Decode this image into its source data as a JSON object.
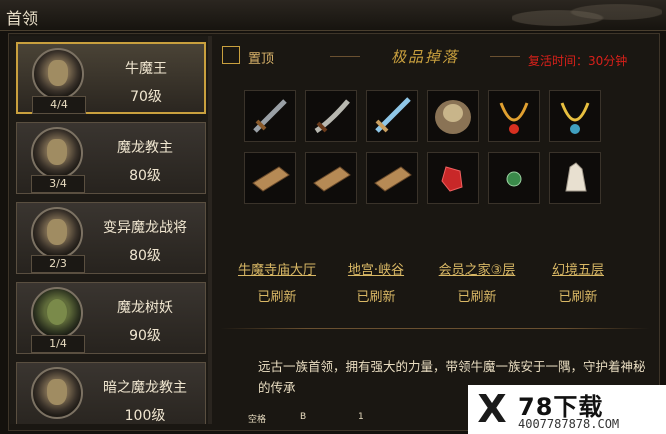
{
  "window": {
    "title": "首领"
  },
  "bosses": [
    {
      "name": "牛魔王",
      "level": "70级",
      "count": "4/4",
      "icon": "bull-demon-portrait",
      "selected": true
    },
    {
      "name": "魔龙教主",
      "level": "80级",
      "count": "3/4",
      "icon": "dragon-cult-master-portrait"
    },
    {
      "name": "变异魔龙战将",
      "level": "80级",
      "count": "2/3",
      "icon": "mutant-dragon-general-portrait"
    },
    {
      "name": "魔龙树妖",
      "level": "90级",
      "count": "1/4",
      "icon": "dragon-tree-demon-portrait"
    },
    {
      "name": "暗之魔龙教主",
      "level": "100级",
      "count": "",
      "icon": "dark-dragon-cult-master-portrait"
    }
  ],
  "pin": {
    "label": "置顶"
  },
  "drops": {
    "title": "极品掉落",
    "respawn": "复活时间：30分钟",
    "items": [
      {
        "icon": "sword-icon"
      },
      {
        "icon": "curved-blade-icon"
      },
      {
        "icon": "blue-sword-icon"
      },
      {
        "icon": "armor-icon"
      },
      {
        "icon": "necklace-red-icon"
      },
      {
        "icon": "necklace-gold-icon"
      },
      {
        "icon": "wooden-plank-icon"
      },
      {
        "icon": "wooden-plank-icon"
      },
      {
        "icon": "wooden-plank-icon"
      },
      {
        "icon": "red-gem-icon"
      },
      {
        "icon": "green-orb-icon"
      },
      {
        "icon": "crystal-icon"
      }
    ]
  },
  "locations": [
    {
      "name": "牛魔寺庙大厅",
      "status": "已刷新"
    },
    {
      "name": "地宫·峡谷",
      "status": "已刷新"
    },
    {
      "name": "会员之家③层",
      "status": "已刷新"
    },
    {
      "name": "幻境五层",
      "status": "已刷新"
    }
  ],
  "description": "远古一族首领，拥有强大的力量，带领牛魔一族安于一隅，守护着神秘的传承",
  "hotkeys": [
    "空格",
    "B",
    "1"
  ],
  "watermark": {
    "mark": "X",
    "brand": "78下载",
    "site": "4007787878.COM"
  },
  "colors": {
    "accent": "#c9a03e",
    "respawn": "#d8201a",
    "location": "#d9b865"
  }
}
